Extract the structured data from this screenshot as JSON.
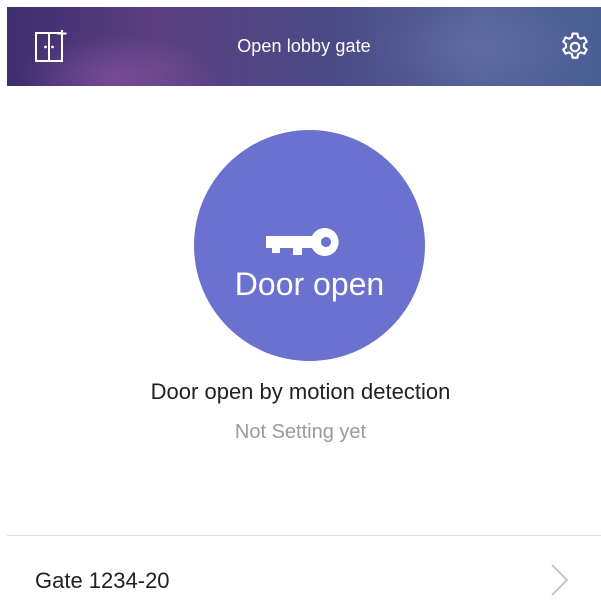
{
  "header": {
    "title": "Open lobby gate",
    "left_icon": "door-icon",
    "right_icon": "gear-icon"
  },
  "main": {
    "button_label": "Door open",
    "button_icon": "key-icon",
    "status_text": "Door open by motion detection",
    "substatus_text": "Not Setting yet"
  },
  "gate": {
    "label": "Gate 1234-20",
    "icon": "chevron-right-icon"
  },
  "colors": {
    "accent": "#6b71cf",
    "header_dark": "#3d2e6e",
    "header_light": "#55639a",
    "text_primary": "#1f1f24",
    "text_secondary": "#9a9a9a"
  }
}
